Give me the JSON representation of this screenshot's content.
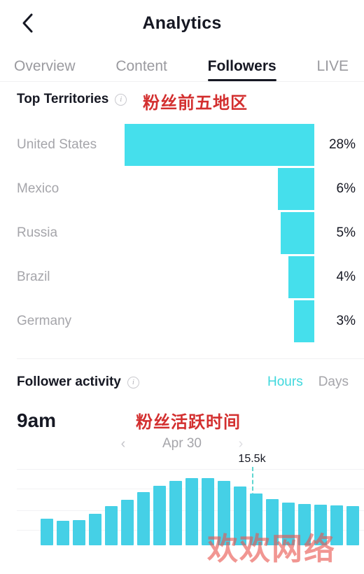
{
  "header": {
    "title": "Analytics",
    "back_icon": "chevron-left-icon"
  },
  "tabs": [
    {
      "label": "Overview",
      "active": false
    },
    {
      "label": "Content",
      "active": false
    },
    {
      "label": "Followers",
      "active": true
    },
    {
      "label": "LIVE",
      "active": false
    }
  ],
  "territories": {
    "title": "Top Territories",
    "info_icon": "info-circle-icon",
    "annotation": "粉丝前五地区",
    "annotation_color": "#d32f2f",
    "bar_color": "#45dfec",
    "rows": [
      {
        "name": "United States",
        "percent": "28%",
        "value": 28
      },
      {
        "name": "Mexico",
        "percent": "6%",
        "value": 6
      },
      {
        "name": "Russia",
        "percent": "5%",
        "value": 5
      },
      {
        "name": "Brazil",
        "percent": "4%",
        "value": 4
      },
      {
        "name": "Germany",
        "percent": "3%",
        "value": 3
      }
    ]
  },
  "follower_activity": {
    "title": "Follower activity",
    "info_icon": "info-circle-icon",
    "toggles": [
      {
        "label": "Hours",
        "active": true
      },
      {
        "label": "Days",
        "active": false
      }
    ],
    "active_color": "#3fd8dd",
    "peak_time": "9am",
    "annotation": "粉丝活跃时间",
    "date_label": "Apr 30",
    "prev_icon": "chevron-left-icon",
    "next_icon": "chevron-right-icon",
    "marker_label": "15.5k",
    "marker_color": "#5fd6d0"
  },
  "watermark": {
    "text": "欢欢网络",
    "color": "rgba(233,86,79,0.62)"
  },
  "chart_data": [
    {
      "type": "bar",
      "title": "Top Territories",
      "orientation": "horizontal",
      "categories": [
        "United States",
        "Mexico",
        "Russia",
        "Brazil",
        "Germany"
      ],
      "values": [
        28,
        6,
        5,
        4,
        3
      ],
      "value_labels": [
        "28%",
        "6%",
        "5%",
        "4%",
        "3%"
      ],
      "unit": "%",
      "xlabel": "",
      "ylabel": "",
      "xlim": [
        0,
        28
      ],
      "grid": false,
      "legend": "none",
      "bar_color": "#45dfec",
      "note": "Bars are right-aligned to a common right edge and grow leftward."
    },
    {
      "type": "bar",
      "title": "Follower activity",
      "subtitle": "Apr 30",
      "peak_label": "9am",
      "xlabel": "",
      "ylabel": "",
      "ylim": [
        0,
        20000
      ],
      "grid": true,
      "gridline_count": 4,
      "legend": "none",
      "bar_color": "#45d0e6",
      "annotation": {
        "label": "15.5k",
        "value": 15500,
        "style": "dashed-vertical",
        "color": "#5fd6d0"
      },
      "x": [
        1,
        2,
        3,
        4,
        5,
        6,
        7,
        8,
        9,
        10,
        11,
        12,
        13,
        14,
        15,
        16,
        17,
        18,
        19,
        20
      ],
      "values": [
        5.2,
        4.9,
        5.0,
        6.2,
        8.0,
        9.4,
        11.3,
        13.0,
        14.3,
        15.0,
        15.2,
        14.6,
        13.2,
        11.6,
        10.3,
        9.6,
        9.2,
        9.0,
        8.8,
        8.6
      ]
    }
  ]
}
